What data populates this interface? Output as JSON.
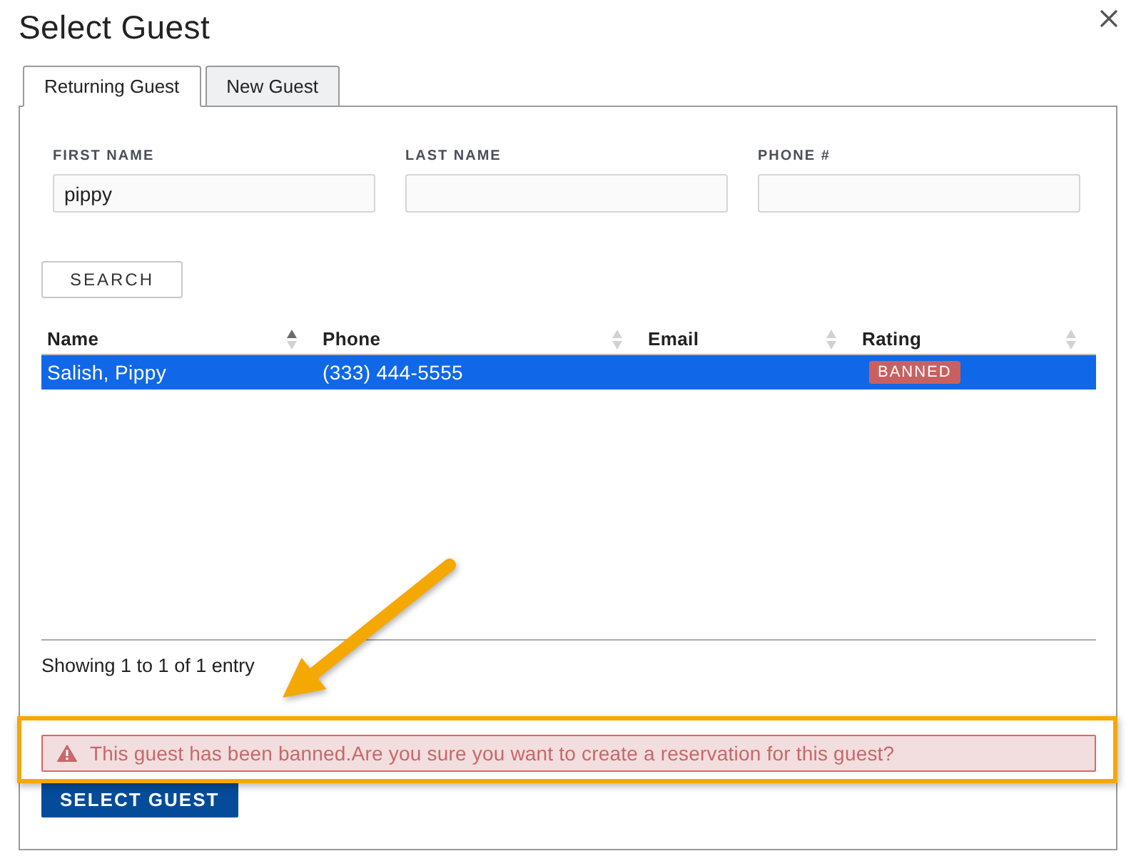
{
  "dialog": {
    "title": "Select Guest"
  },
  "tabs": [
    {
      "label": "Returning Guest",
      "selected": true
    },
    {
      "label": "New Guest",
      "selected": false
    }
  ],
  "form": {
    "fields": [
      {
        "label": "FIRST NAME",
        "value": "pippy"
      },
      {
        "label": "LAST NAME"
      },
      {
        "label": "PHONE #"
      }
    ],
    "search_button": "SEARCH"
  },
  "table": {
    "columns": [
      {
        "label": "Name",
        "sorted": true
      },
      {
        "label": "Phone",
        "sorted": false
      },
      {
        "label": "Email",
        "sorted": false
      },
      {
        "label": "Rating",
        "sorted": false
      }
    ],
    "rows": [
      {
        "name": "Salish, Pippy",
        "phone": "(333) 444-5555",
        "rating": "BANNED",
        "selected": true
      }
    ],
    "info": "Showing 1 to 1 of 1 entry"
  },
  "alert": {
    "kind": "danger",
    "text": "This guest has been banned.Are you sure you want to create a reservation for this guest?"
  },
  "select_button": "SELECT GUEST",
  "annotation": {
    "arrow": true,
    "highlight_frame": true
  }
}
